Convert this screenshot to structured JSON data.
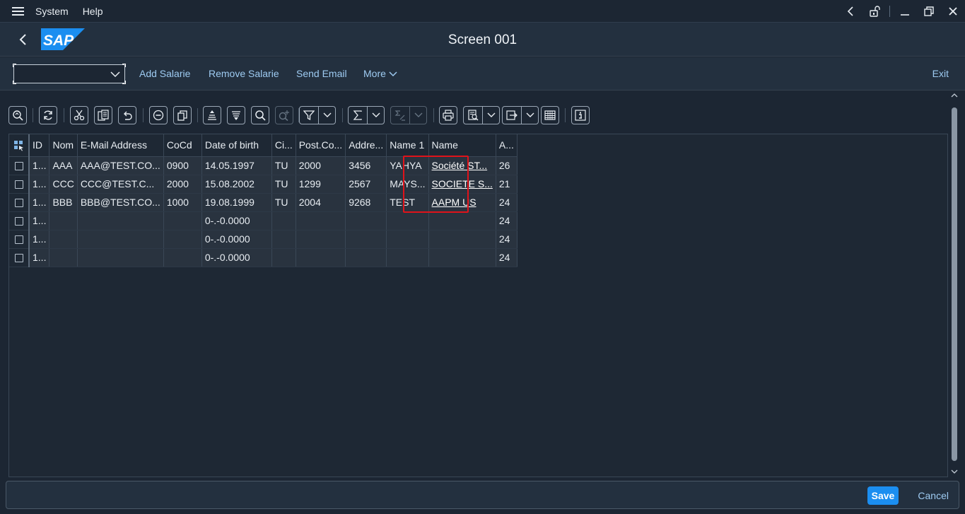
{
  "menu": {
    "system": "System",
    "help": "Help"
  },
  "header": {
    "title": "Screen 001",
    "logo_text": "SAP"
  },
  "toolbar": {
    "command_field_value": "",
    "add_salarie": "Add Salarie",
    "remove_salarie": "Remove Salarie",
    "send_email": "Send Email",
    "more": "More",
    "exit": "Exit"
  },
  "grid": {
    "columns": [
      "ID",
      "Nom",
      "E-Mail Address",
      "CoCd",
      "Date of birth",
      "Ci...",
      "Post.Co...",
      "Addre...",
      "Name 1",
      "Name",
      "A..."
    ],
    "rows": [
      [
        "1...",
        "AAA",
        "AAA@TEST.CO...",
        "0900",
        "14.05.1997",
        "TU",
        "2000",
        "3456",
        "YAHYA",
        "Société ST...",
        "26"
      ],
      [
        "1...",
        "CCC",
        "CCC@TEST.C...",
        "2000",
        "15.08.2002",
        "TU",
        "1299",
        "2567",
        "MAYS...",
        "SOCIETE S...",
        "21"
      ],
      [
        "1...",
        "BBB",
        "BBB@TEST.CO...",
        "1000",
        "19.08.1999",
        "TU",
        "2004",
        "9268",
        "TEST",
        "AAPM US",
        "24"
      ],
      [
        "1...",
        "",
        "",
        "",
        "0-.-0.0000",
        "",
        "",
        "",
        "",
        "",
        "24"
      ],
      [
        "1...",
        "",
        "",
        "",
        "0-.-0.0000",
        "",
        "",
        "",
        "",
        "",
        "24"
      ],
      [
        "1...",
        "",
        "",
        "",
        "0-.-0.0000",
        "",
        "",
        "",
        "",
        "",
        "24"
      ]
    ]
  },
  "footer": {
    "save": "Save",
    "cancel": "Cancel"
  },
  "colors": {
    "background": "#1c2633",
    "bar": "#23303f",
    "link": "#9ecbf2",
    "emphasized": "#1b8ef0",
    "highlight": "#e0131a"
  }
}
